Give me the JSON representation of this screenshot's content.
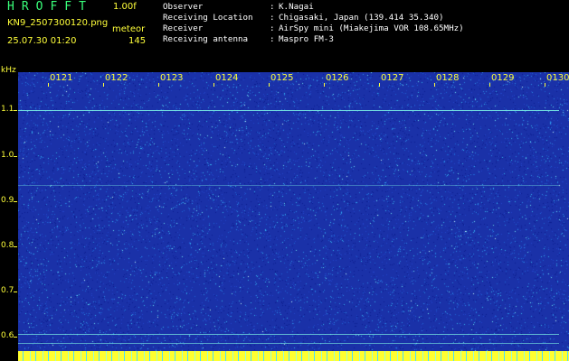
{
  "header": {
    "app_title": "HROFFT",
    "version": "1.00f",
    "filename": "KN9_2507300120.png",
    "meteor_label": "meteor",
    "timestamp": "25.07.30 01:20",
    "meteor_count": "145"
  },
  "info": [
    {
      "label": "Observer",
      "value": "K.Nagai"
    },
    {
      "label": "Receiving Location",
      "value": "Chigasaki, Japan (139.414 35.340)"
    },
    {
      "label": "Receiver",
      "value": "AirSpy mini (Miakejima VOR 108.65MHz)"
    },
    {
      "label": "Receiving antenna",
      "value": "Maspro FM-3"
    }
  ],
  "info_separator": ":",
  "axis": {
    "unit": "kHz",
    "y_labels": [
      "1.1",
      "1.0",
      "0.9",
      "0.8",
      "0.7",
      "0.6"
    ],
    "x_labels": [
      "0121",
      "0122",
      "0123",
      "0124",
      "0125",
      "0126",
      "0127",
      "0128",
      "0129",
      "0130"
    ]
  },
  "colors": {
    "background": "#000000",
    "spectrogram_base": "#1a31a8",
    "text_yellow": "#ffff3a",
    "title_green": "#39ff7a",
    "reference_line": "#7ef5e6"
  }
}
